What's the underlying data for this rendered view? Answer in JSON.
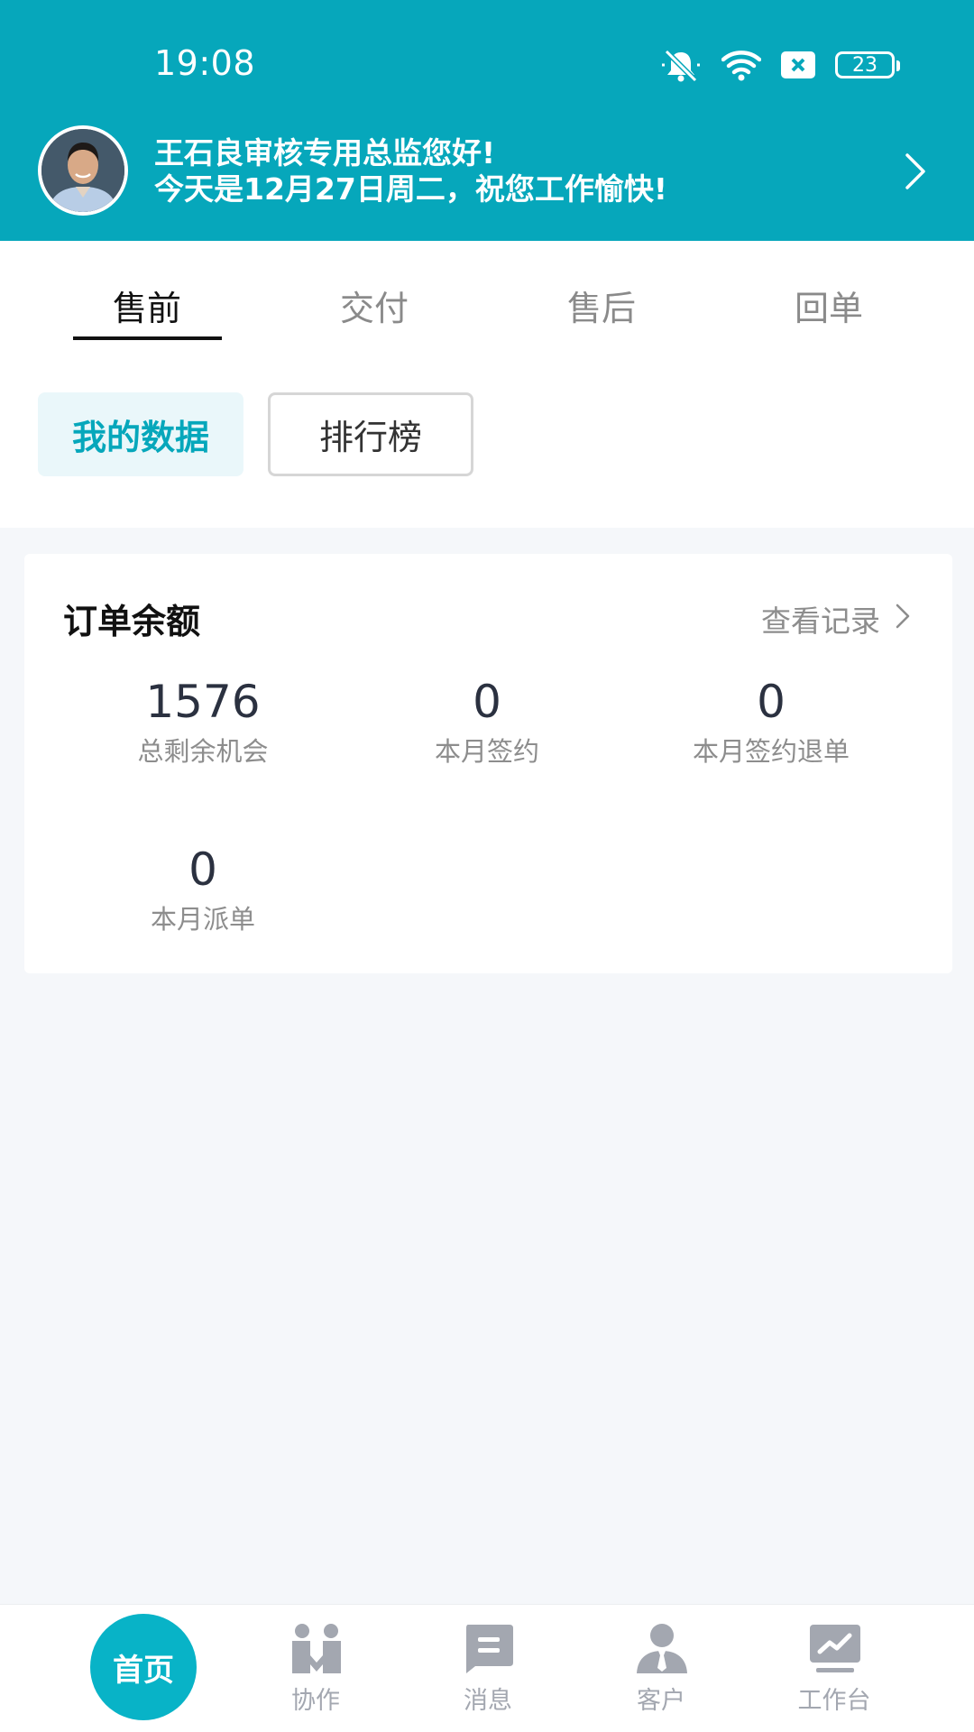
{
  "status_bar": {
    "time": "19:08",
    "battery": "23"
  },
  "greeting": {
    "line1": "王石良审核专用总监您好!",
    "line2": "今天是12月27日周二，祝您工作愉快!"
  },
  "tabs": [
    {
      "label": "售前",
      "active": true
    },
    {
      "label": "交付",
      "active": false
    },
    {
      "label": "售后",
      "active": false
    },
    {
      "label": "回单",
      "active": false
    }
  ],
  "subtabs": {
    "mine": "我的数据",
    "rank": "排行榜"
  },
  "card": {
    "title": "订单余额",
    "view_records": "查看记录",
    "stats": [
      {
        "value": "1576",
        "label": "总剩余机会"
      },
      {
        "value": "0",
        "label": "本月签约"
      },
      {
        "value": "0",
        "label": "本月签约退单"
      },
      {
        "value": "0",
        "label": "本月派单"
      }
    ]
  },
  "bottom_nav": {
    "home": "首页",
    "collab": "协作",
    "messages": "消息",
    "customers": "客户",
    "workbench": "工作台"
  },
  "colors": {
    "accent": "#06a7bb",
    "home_button": "#08b3c7",
    "nav_icon": "#a3a7b0"
  }
}
